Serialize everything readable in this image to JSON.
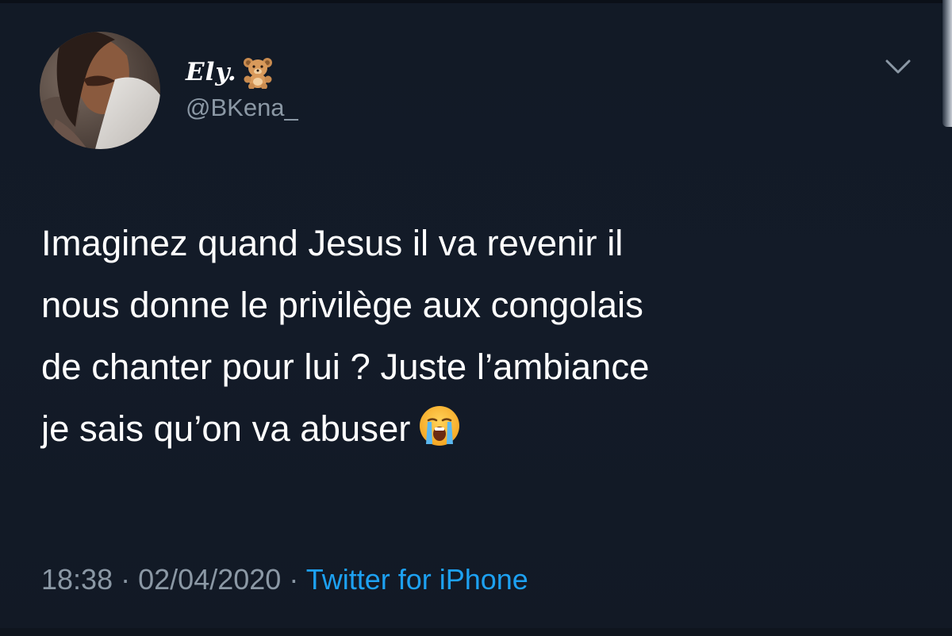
{
  "tweet": {
    "display_name": "Ely.",
    "name_emoji_icon": "teddy-bear-icon",
    "handle": "@BKena_",
    "text_lines": [
      "Imaginez quand Jesus il va revenir il",
      "nous donne le privilège aux congolais",
      "de chanter pour lui ? Juste l’ambiance",
      "je sais qu’on va abuser"
    ],
    "text_end_emoji_icon": "loudly-crying-face-icon",
    "time": "18:38",
    "separator": "·",
    "date": "02/04/2020",
    "source": "Twitter for iPhone",
    "menu_icon": "chevron-down-icon"
  },
  "colors": {
    "background": "#131b28",
    "secondary_text": "#8b98a5",
    "link": "#1da1f2",
    "primary_text": "#ffffff"
  }
}
